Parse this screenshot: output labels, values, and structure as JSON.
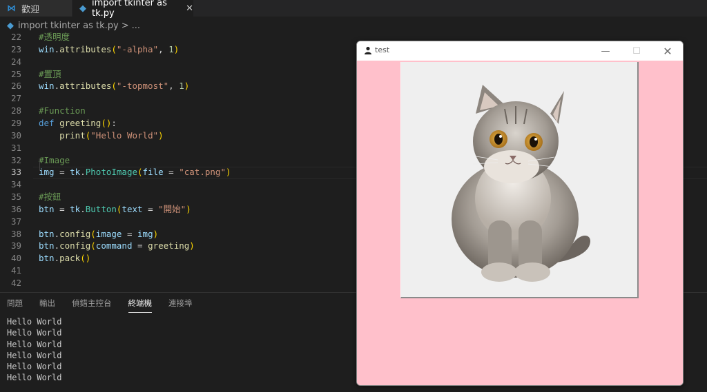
{
  "tabs": [
    {
      "label": "歡迎",
      "icon": "vscode-icon"
    },
    {
      "label": "import tkinter as tk.py",
      "icon": "python-file-icon",
      "active": true,
      "close": "✕"
    }
  ],
  "breadcrumb": {
    "file": "import tkinter as tk.py",
    "sep": ">",
    "rest": "..."
  },
  "editor": {
    "lines": [
      {
        "n": "22",
        "tokens": [
          {
            "c": "t-cmt",
            "t": "#透明度"
          }
        ]
      },
      {
        "n": "23",
        "tokens": [
          {
            "c": "t-id",
            "t": "win"
          },
          {
            "c": "t-p",
            "t": "."
          },
          {
            "c": "t-fn",
            "t": "attributes"
          },
          {
            "c": "t-br",
            "t": "("
          },
          {
            "c": "t-str",
            "t": "\"-alpha\""
          },
          {
            "c": "t-p",
            "t": ", "
          },
          {
            "c": "t-num",
            "t": "1"
          },
          {
            "c": "t-br",
            "t": ")"
          }
        ]
      },
      {
        "n": "24",
        "tokens": []
      },
      {
        "n": "25",
        "tokens": [
          {
            "c": "t-cmt",
            "t": "#置頂"
          }
        ]
      },
      {
        "n": "26",
        "tokens": [
          {
            "c": "t-id",
            "t": "win"
          },
          {
            "c": "t-p",
            "t": "."
          },
          {
            "c": "t-fn",
            "t": "attributes"
          },
          {
            "c": "t-br",
            "t": "("
          },
          {
            "c": "t-str",
            "t": "\"-topmost\""
          },
          {
            "c": "t-p",
            "t": ", "
          },
          {
            "c": "t-num",
            "t": "1"
          },
          {
            "c": "t-br",
            "t": ")"
          }
        ]
      },
      {
        "n": "27",
        "tokens": []
      },
      {
        "n": "28",
        "tokens": [
          {
            "c": "t-cmt",
            "t": "#Function"
          }
        ]
      },
      {
        "n": "29",
        "tokens": [
          {
            "c": "t-kw",
            "t": "def "
          },
          {
            "c": "t-fn",
            "t": "greeting"
          },
          {
            "c": "t-br",
            "t": "()"
          },
          {
            "c": "t-p",
            "t": ":"
          }
        ]
      },
      {
        "n": "30",
        "tokens": [
          {
            "c": "t-p",
            "t": "    "
          },
          {
            "c": "t-fn",
            "t": "print"
          },
          {
            "c": "t-br",
            "t": "("
          },
          {
            "c": "t-str",
            "t": "\"Hello World\""
          },
          {
            "c": "t-br",
            "t": ")"
          }
        ]
      },
      {
        "n": "31",
        "tokens": []
      },
      {
        "n": "32",
        "tokens": [
          {
            "c": "t-cmt",
            "t": "#Image"
          }
        ]
      },
      {
        "n": "33",
        "current": true,
        "tokens": [
          {
            "c": "t-id",
            "t": "img"
          },
          {
            "c": "t-p",
            "t": " = "
          },
          {
            "c": "t-id",
            "t": "tk"
          },
          {
            "c": "t-p",
            "t": "."
          },
          {
            "c": "t-cls",
            "t": "PhotoImage"
          },
          {
            "c": "t-br",
            "t": "("
          },
          {
            "c": "t-id",
            "t": "file"
          },
          {
            "c": "t-p",
            "t": " = "
          },
          {
            "c": "t-str",
            "t": "\"cat.png\""
          },
          {
            "c": "t-br",
            "t": ")"
          }
        ]
      },
      {
        "n": "34",
        "tokens": []
      },
      {
        "n": "35",
        "tokens": [
          {
            "c": "t-cmt",
            "t": "#按鈕"
          }
        ]
      },
      {
        "n": "36",
        "tokens": [
          {
            "c": "t-id",
            "t": "btn"
          },
          {
            "c": "t-p",
            "t": " = "
          },
          {
            "c": "t-id",
            "t": "tk"
          },
          {
            "c": "t-p",
            "t": "."
          },
          {
            "c": "t-cls",
            "t": "Button"
          },
          {
            "c": "t-br",
            "t": "("
          },
          {
            "c": "t-id",
            "t": "text"
          },
          {
            "c": "t-p",
            "t": " = "
          },
          {
            "c": "t-str",
            "t": "\"開始\""
          },
          {
            "c": "t-br",
            "t": ")"
          }
        ]
      },
      {
        "n": "37",
        "tokens": []
      },
      {
        "n": "38",
        "tokens": [
          {
            "c": "t-id",
            "t": "btn"
          },
          {
            "c": "t-p",
            "t": "."
          },
          {
            "c": "t-fn",
            "t": "config"
          },
          {
            "c": "t-br",
            "t": "("
          },
          {
            "c": "t-id",
            "t": "image"
          },
          {
            "c": "t-p",
            "t": " = "
          },
          {
            "c": "t-id",
            "t": "img"
          },
          {
            "c": "t-br",
            "t": ")"
          }
        ]
      },
      {
        "n": "39",
        "tokens": [
          {
            "c": "t-id",
            "t": "btn"
          },
          {
            "c": "t-p",
            "t": "."
          },
          {
            "c": "t-fn",
            "t": "config"
          },
          {
            "c": "t-br",
            "t": "("
          },
          {
            "c": "t-id",
            "t": "command"
          },
          {
            "c": "t-p",
            "t": " = "
          },
          {
            "c": "t-fn",
            "t": "greeting"
          },
          {
            "c": "t-br",
            "t": ")"
          }
        ]
      },
      {
        "n": "40",
        "tokens": [
          {
            "c": "t-id",
            "t": "btn"
          },
          {
            "c": "t-p",
            "t": "."
          },
          {
            "c": "t-fn",
            "t": "pack"
          },
          {
            "c": "t-br",
            "t": "()"
          }
        ]
      },
      {
        "n": "41",
        "tokens": []
      },
      {
        "n": "42",
        "tokens": []
      }
    ]
  },
  "panel": {
    "tabs": [
      "問題",
      "輸出",
      "偵錯主控台",
      "終端機",
      "連接埠"
    ],
    "active": "終端機",
    "output": [
      "Hello World",
      "Hello World",
      "Hello World",
      "Hello World",
      "Hello World",
      "Hello World"
    ]
  },
  "tkwindow": {
    "title": "test",
    "icon": "user-icon",
    "buttons": {
      "min": "—",
      "max": "☐",
      "close": "✕"
    },
    "background": "#ffc0cb",
    "image": "cat-photo"
  }
}
